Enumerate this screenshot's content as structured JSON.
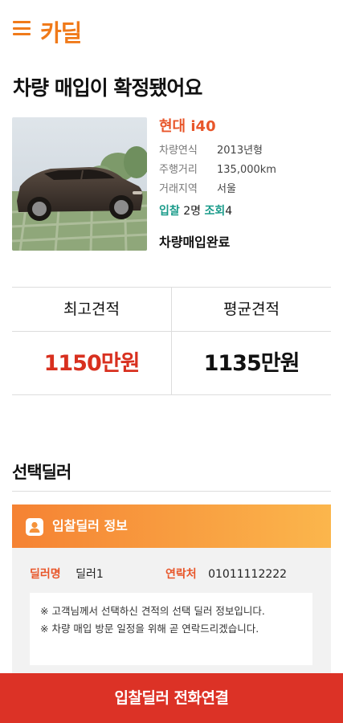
{
  "header": {
    "logo": "카딜"
  },
  "page": {
    "title": "차량 매입이 확정됐어요"
  },
  "car": {
    "name": "현대 i40",
    "specs": [
      {
        "label": "차량연식",
        "value": "2013년형"
      },
      {
        "label": "주행거리",
        "value": "135,000km"
      },
      {
        "label": "거래지역",
        "value": "서울"
      }
    ],
    "bids_label": "입찰",
    "bids_value": "2명",
    "views_label": "조회",
    "views_value": "4",
    "status": "차량매입완료"
  },
  "quotes": {
    "max_label": "최고견적",
    "max_value": "1150만원",
    "avg_label": "평균견적",
    "avg_value": "1135만원",
    "max_color": "#d8301f"
  },
  "selected_dealer": {
    "section_title": "선택딜러",
    "card_title": "입찰딜러 정보",
    "name_label": "딜러명",
    "name_value": "딜러1",
    "contact_label": "연락처",
    "contact_value": "01011112222",
    "notice_1": "※ 고객님께서 선택하신 견적의 선택 딜러 정보입니다.",
    "notice_2": "※ 차량 매입 방문 일정을 위해 곧 연락드리겠습니다."
  },
  "cta": {
    "label": "입찰딜러 전화연결"
  },
  "colors": {
    "accent": "#f07a1a",
    "cta": "#dc3226",
    "teal": "#1a9b8a"
  },
  "icons": [
    "hamburger-menu-icon",
    "person-icon"
  ]
}
